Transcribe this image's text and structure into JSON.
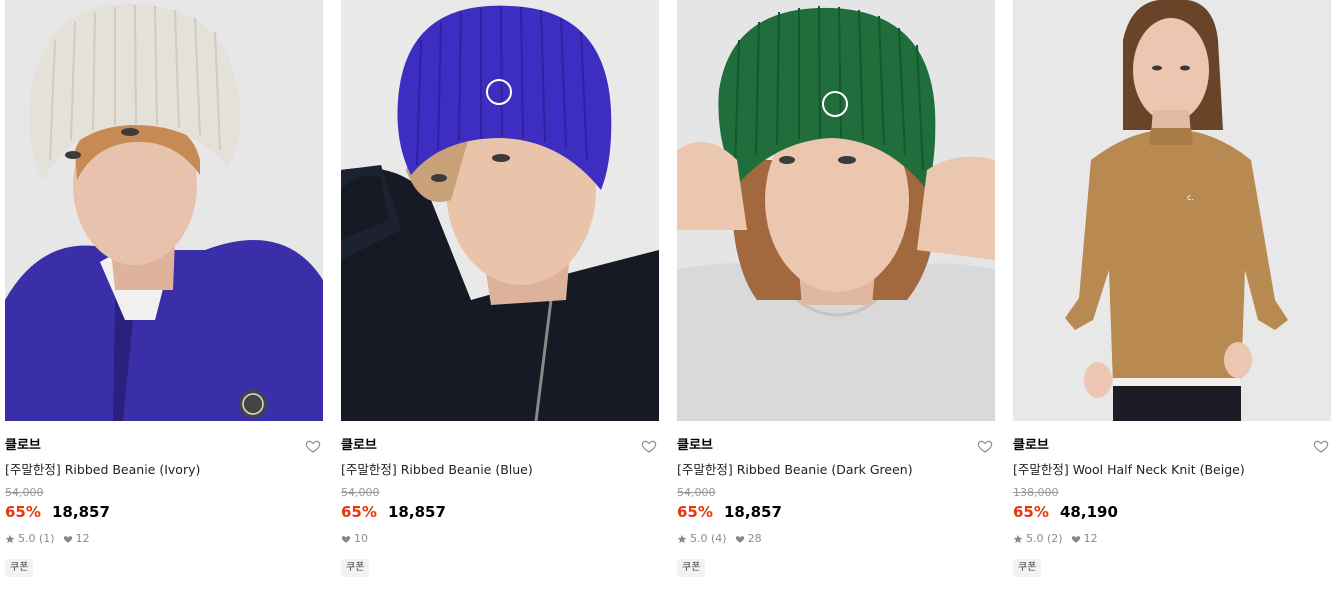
{
  "products": [
    {
      "brand": "클로브",
      "name": "[주말한정] Ribbed Beanie (Ivory)",
      "original_price": "54,000",
      "discount": "65%",
      "price": "18,857",
      "rating": "5.0",
      "review_count": "(1)",
      "likes": "12",
      "coupon_label": "쿠폰",
      "colors": {
        "background": "#e7e7e8",
        "hat": "#e4e1d8",
        "garment": "#3a2fa8",
        "skin": "#e8c2ac",
        "hair": "#c88a54"
      }
    },
    {
      "brand": "클로브",
      "name": "[주말한정] Ribbed Beanie (Blue)",
      "original_price": "54,000",
      "discount": "65%",
      "price": "18,857",
      "rating": "",
      "review_count": "",
      "likes": "10",
      "coupon_label": "쿠폰",
      "colors": {
        "background": "#e9e9ea",
        "hat": "#3d2ec1",
        "garment": "#161a24",
        "skin": "#e9c3aa",
        "hair": "#caa27a"
      }
    },
    {
      "brand": "클로브",
      "name": "[주말한정] Ribbed Beanie (Dark Green)",
      "original_price": "54,000",
      "discount": "65%",
      "price": "18,857",
      "rating": "5.0",
      "review_count": "(4)",
      "likes": "28",
      "coupon_label": "쿠폰",
      "colors": {
        "background": "#e5e5e6",
        "hat": "#1f6e3b",
        "garment": "#d9d9d9",
        "skin": "#ecc7b0",
        "hair": "#a2693f"
      }
    },
    {
      "brand": "클로브",
      "name": "[주말한정] Wool Half Neck Knit (Beige)",
      "original_price": "138,000",
      "discount": "65%",
      "price": "48,190",
      "rating": "5.0",
      "review_count": "(2)",
      "likes": "12",
      "coupon_label": "쿠폰",
      "colors": {
        "background": "#e8e8e9",
        "hat": "#5a3a22",
        "garment": "#b88a52",
        "skin": "#ecc6b1",
        "hair": "#6a4428"
      }
    }
  ],
  "icons": {
    "wishlist": "heart-outline-icon",
    "rating": "star-icon",
    "likes": "heart-filled-icon"
  },
  "accent_colors": {
    "discount": "#e5380b",
    "text": "#111111",
    "muted": "#999999"
  }
}
